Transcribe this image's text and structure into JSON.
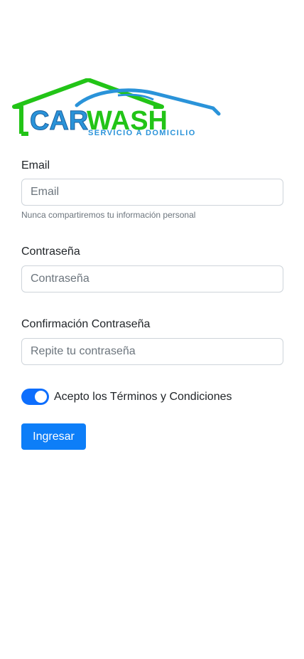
{
  "logo": {
    "word_car": "CAR",
    "word_wash": "WASH",
    "tagline": "SERVICIO A DOMICILIO",
    "colors": {
      "green": "#22c417",
      "blue": "#2a93d9",
      "dark_blue": "#1b5f9e"
    }
  },
  "form": {
    "email": {
      "label": "Email",
      "placeholder": "Email",
      "value": "",
      "help": "Nunca compartiremos tu información personal"
    },
    "password": {
      "label": "Contraseña",
      "placeholder": "Contraseña",
      "value": ""
    },
    "confirm_password": {
      "label": "Confirmación Contraseña",
      "placeholder": "Repite tu contraseña",
      "value": ""
    },
    "terms": {
      "label": "Acepto los Términos y Condiciones",
      "checked": true
    },
    "submit_label": "Ingresar"
  },
  "theme": {
    "primary": "#0d6efd",
    "border": "#ced4da",
    "muted": "#6c757d"
  }
}
